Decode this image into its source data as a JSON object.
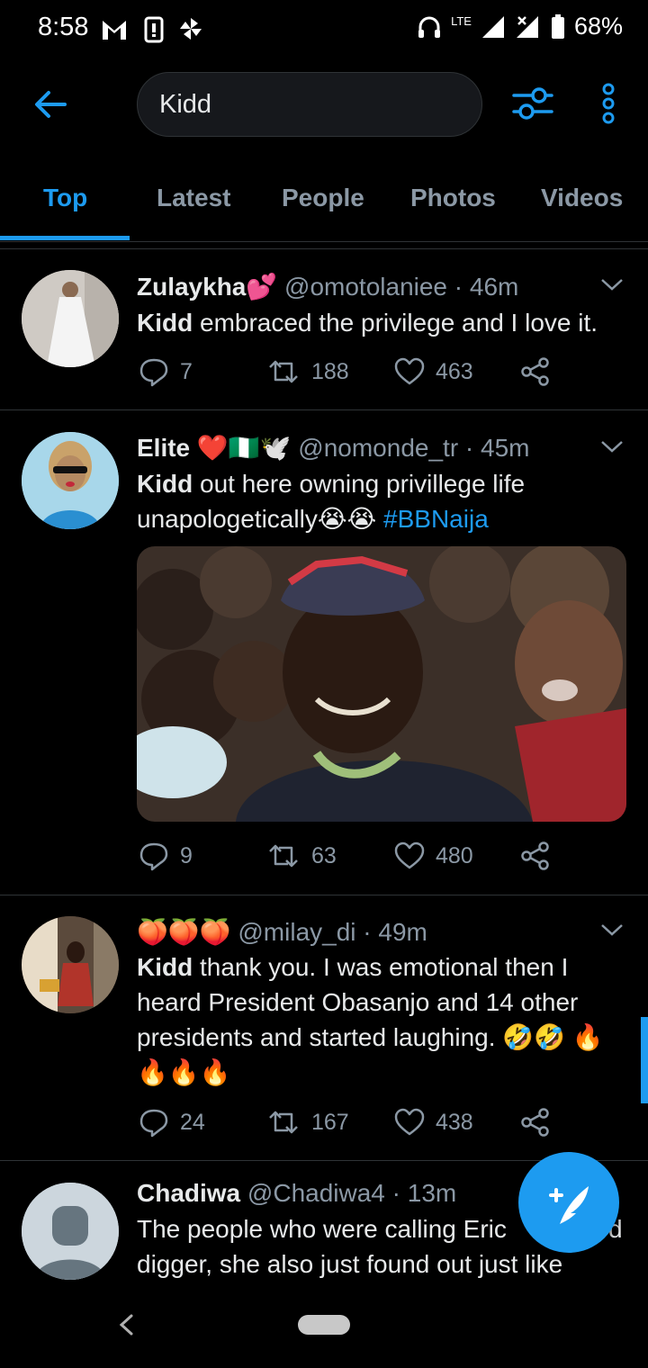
{
  "status_bar": {
    "time": "8:58",
    "network": "LTE",
    "battery": "68%"
  },
  "search": {
    "query": "Kidd"
  },
  "tabs": [
    {
      "label": "Top",
      "active": true
    },
    {
      "label": "Latest",
      "active": false
    },
    {
      "label": "People",
      "active": false
    },
    {
      "label": "Photos",
      "active": false
    },
    {
      "label": "Videos",
      "active": false
    }
  ],
  "tweets": [
    {
      "name": "Zulaykha💕",
      "handle": "@omotolaniee",
      "time": "· 46m",
      "bold": "Kidd",
      "text": " embraced the privilege and I love it.",
      "replies": "7",
      "retweets": "188",
      "likes": "463"
    },
    {
      "name": "Elite ❤️🇳🇬🕊️",
      "handle": "@nomonde_tr",
      "time": "· 45m",
      "bold": "Kidd",
      "text": " out here owning privillege life unapologetically😭😭 ",
      "hashtag": "#BBNaija",
      "replies": "9",
      "retweets": "63",
      "likes": "480"
    },
    {
      "name": "🍑🍑🍑",
      "handle": "@milay_di",
      "time": "· 49m",
      "bold": "Kidd",
      "text": " thank you. I was emotional then I heard President Obasanjo and 14 other presidents and started laughing. 🤣🤣 🔥🔥🔥🔥",
      "replies": "24",
      "retweets": "167",
      "likes": "438"
    },
    {
      "name": "Chadiwa",
      "handle": "@Chadiwa4",
      "time": "· 13m",
      "text": "The people who were calling Eric",
      "text_tail": "d",
      "text_line2": "digger, she also just found out just like"
    }
  ],
  "colors": {
    "accent": "#1d9bf0",
    "muted": "#8b98a5",
    "background": "#000000",
    "divider": "#2f3336"
  },
  "icons": [
    "back-arrow-icon",
    "filter-icon",
    "more-vertical-icon",
    "reply-icon",
    "retweet-icon",
    "like-icon",
    "share-icon",
    "chevron-down-icon",
    "compose-icon",
    "nav-back-icon"
  ]
}
